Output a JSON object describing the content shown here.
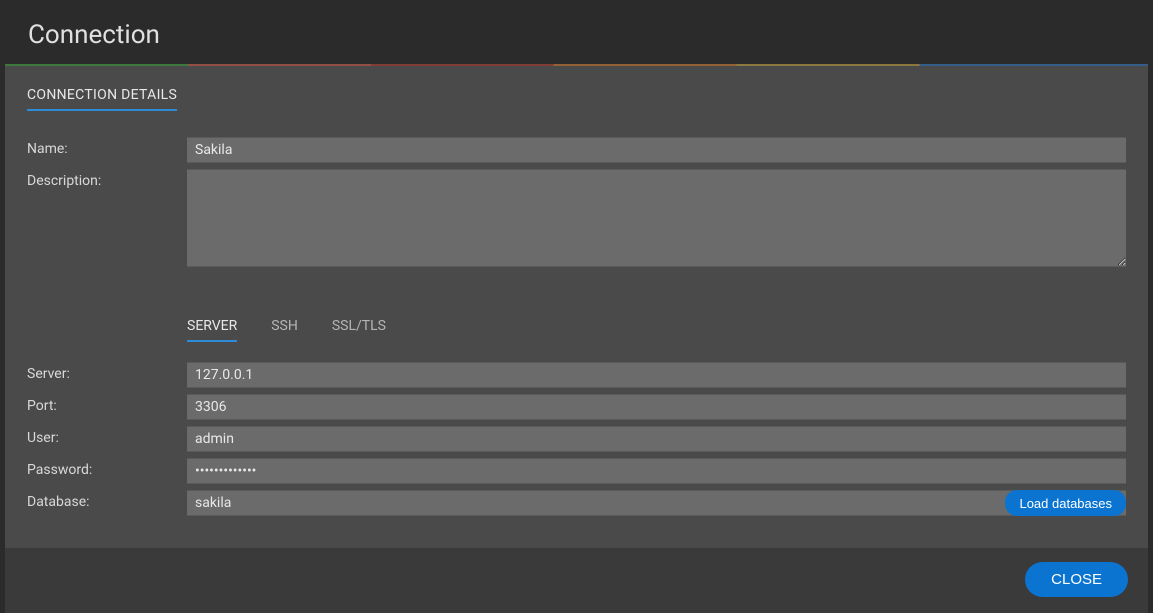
{
  "dialog": {
    "title": "Connection",
    "section_tab": "CONNECTION DETAILS",
    "close": "CLOSE"
  },
  "labels": {
    "name": "Name:",
    "description": "Description:",
    "server": "Server:",
    "port": "Port:",
    "user": "User:",
    "password": "Password:",
    "database": "Database:"
  },
  "tabs": {
    "server": "SERVER",
    "ssh": "SSH",
    "ssl": "SSL/TLS"
  },
  "fields": {
    "name": "Sakila",
    "description": "",
    "server": "127.0.0.1",
    "port": "3306",
    "user": "admin",
    "password": "•••••••••••••",
    "database": "sakila"
  },
  "buttons": {
    "load_db": "Load databases"
  }
}
